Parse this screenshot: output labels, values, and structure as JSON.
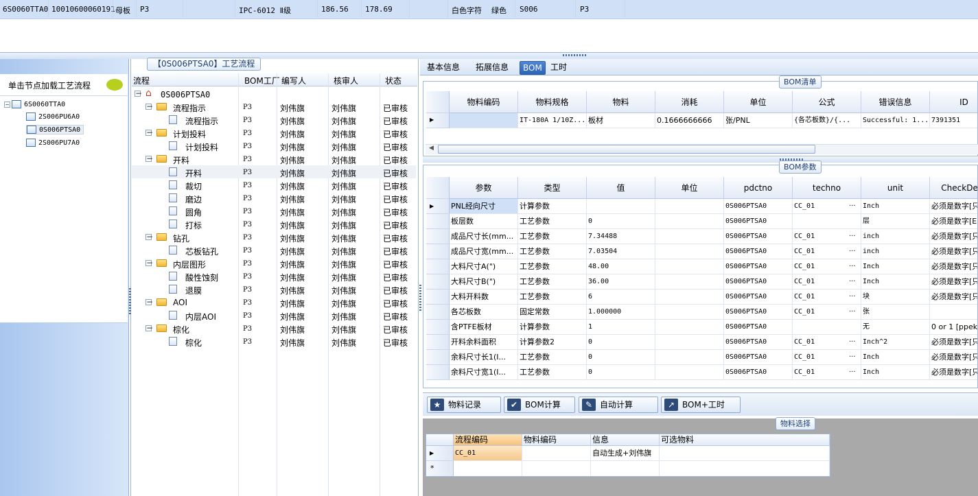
{
  "top_record": {
    "cells": [
      "6S0060TTA0",
      "10010600060191",
      "母板",
      "P3",
      "IPC-6012 Ⅱ级",
      "186.56",
      "178.69",
      "白色字符",
      "绿色",
      "S006",
      "P3"
    ]
  },
  "left_panel": {
    "hint": "单击节点加载工艺流程",
    "tree": [
      "6S0060TTA0",
      "2S006PU6A0",
      "0S006PTSA0",
      "2S006PU7A0"
    ]
  },
  "process_panel": {
    "title": "【0S006PTSA0】工艺流程",
    "columns": [
      "流程",
      "BOM工厂",
      "编写人",
      "核审人",
      "状态"
    ],
    "root": "0S006PTSA0",
    "rows": [
      {
        "name": "流程指示",
        "level": 1,
        "folder": true,
        "factory": "P3",
        "writer": "刘伟旗",
        "reviewer": "刘伟旗",
        "status": "已审核"
      },
      {
        "name": "流程指示",
        "level": 2,
        "folder": false,
        "factory": "P3",
        "writer": "刘伟旗",
        "reviewer": "刘伟旗",
        "status": "已审核"
      },
      {
        "name": "计划投料",
        "level": 1,
        "folder": true,
        "factory": "P3",
        "writer": "刘伟旗",
        "reviewer": "刘伟旗",
        "status": "已审核"
      },
      {
        "name": "计划投料",
        "level": 2,
        "folder": false,
        "factory": "P3",
        "writer": "刘伟旗",
        "reviewer": "刘伟旗",
        "status": "已审核"
      },
      {
        "name": "开料",
        "level": 1,
        "folder": true,
        "factory": "P3",
        "writer": "刘伟旗",
        "reviewer": "刘伟旗",
        "status": "已审核"
      },
      {
        "name": "开料",
        "level": 2,
        "folder": false,
        "factory": "P3",
        "writer": "刘伟旗",
        "reviewer": "刘伟旗",
        "status": "已审核"
      },
      {
        "name": "裁切",
        "level": 2,
        "folder": false,
        "factory": "P3",
        "writer": "刘伟旗",
        "reviewer": "刘伟旗",
        "status": "已审核"
      },
      {
        "name": "磨边",
        "level": 2,
        "folder": false,
        "factory": "P3",
        "writer": "刘伟旗",
        "reviewer": "刘伟旗",
        "status": "已审核"
      },
      {
        "name": "圆角",
        "level": 2,
        "folder": false,
        "factory": "P3",
        "writer": "刘伟旗",
        "reviewer": "刘伟旗",
        "status": "已审核"
      },
      {
        "name": "打标",
        "level": 2,
        "folder": false,
        "factory": "P3",
        "writer": "刘伟旗",
        "reviewer": "刘伟旗",
        "status": "已审核"
      },
      {
        "name": "钻孔",
        "level": 1,
        "folder": true,
        "factory": "P3",
        "writer": "刘伟旗",
        "reviewer": "刘伟旗",
        "status": "已审核"
      },
      {
        "name": "芯板钻孔",
        "level": 2,
        "folder": false,
        "factory": "P3",
        "writer": "刘伟旗",
        "reviewer": "刘伟旗",
        "status": "已审核"
      },
      {
        "name": "内层图形",
        "level": 1,
        "folder": true,
        "factory": "P3",
        "writer": "刘伟旗",
        "reviewer": "刘伟旗",
        "status": "已审核"
      },
      {
        "name": "酸性蚀刻",
        "level": 2,
        "folder": false,
        "factory": "P3",
        "writer": "刘伟旗",
        "reviewer": "刘伟旗",
        "status": "已审核"
      },
      {
        "name": "退膜",
        "level": 2,
        "folder": false,
        "factory": "P3",
        "writer": "刘伟旗",
        "reviewer": "刘伟旗",
        "status": "已审核"
      },
      {
        "name": "AOI",
        "level": 1,
        "folder": true,
        "factory": "P3",
        "writer": "刘伟旗",
        "reviewer": "刘伟旗",
        "status": "已审核"
      },
      {
        "name": "内层AOI",
        "level": 2,
        "folder": false,
        "factory": "P3",
        "writer": "刘伟旗",
        "reviewer": "刘伟旗",
        "status": "已审核"
      },
      {
        "name": "棕化",
        "level": 1,
        "folder": true,
        "factory": "P3",
        "writer": "刘伟旗",
        "reviewer": "刘伟旗",
        "status": "已审核"
      },
      {
        "name": "棕化",
        "level": 2,
        "folder": false,
        "factory": "P3",
        "writer": "刘伟旗",
        "reviewer": "刘伟旗",
        "status": "已审核"
      }
    ]
  },
  "tabs": [
    "基本信息",
    "拓展信息",
    "BOM",
    "工时"
  ],
  "active_tab": "BOM",
  "bom_list": {
    "title": "BOM清单",
    "columns": [
      "物料编码",
      "物料规格",
      "物料",
      "消耗",
      "单位",
      "公式",
      "错误信息",
      "ID"
    ],
    "rows": [
      [
        "",
        "IT-180A 1/10Z...",
        "板材",
        "0.1666666666",
        "张/PNL",
        "{各芯板数}/{...",
        "Successful: 1...",
        "7391351"
      ]
    ]
  },
  "bom_params": {
    "title": "BOM参数",
    "columns": [
      "参数",
      "类型",
      "值",
      "单位",
      "pdctno",
      "techno",
      "unit",
      "CheckDesc"
    ],
    "rows": [
      [
        "PNL经向尺寸",
        "计算参数",
        "",
        "",
        "0S006PTSA0",
        "CC_01",
        "Inch",
        "必须是数字[只"
      ],
      [
        "板层数",
        "工艺参数",
        "0",
        "",
        "0S006PTSA0",
        "",
        "层",
        "必须是数字[E"
      ],
      [
        "成品尺寸长(mm...",
        "工艺参数",
        "7.34488",
        "",
        "0S006PTSA0",
        "CC_01",
        "inch",
        "必须是数字[只"
      ],
      [
        "成品尺寸宽(mm...",
        "工艺参数",
        "7.03504",
        "",
        "0S006PTSA0",
        "CC_01",
        "inch",
        "必须是数字[只"
      ],
      [
        "大料尺寸A(\")",
        "工艺参数",
        "48.00",
        "",
        "0S006PTSA0",
        "CC_01",
        "Inch",
        "必须是数字[只"
      ],
      [
        "大料尺寸B(\")",
        "工艺参数",
        "36.00",
        "",
        "0S006PTSA0",
        "CC_01",
        "Inch",
        "必须是数字[只"
      ],
      [
        "大料开料数",
        "工艺参数",
        "6",
        "",
        "0S006PTSA0",
        "CC_01",
        "块",
        "必须是数字[只"
      ],
      [
        "各芯板数",
        "固定常数",
        "1.000000",
        "",
        "0S006PTSA0",
        "CC_01",
        "张",
        ""
      ],
      [
        "含PTFE板材",
        "计算参数",
        "1",
        "",
        "0S006PTSA0",
        "",
        "无",
        "0 or 1 [ppek"
      ],
      [
        "开料余料面积",
        "计算参数2",
        "0",
        "",
        "0S006PTSA0",
        "CC_01",
        "Inch^2",
        "必须是数字[只"
      ],
      [
        "余料尺寸长1(I...",
        "工艺参数",
        "0",
        "",
        "0S006PTSA0",
        "CC_01",
        "Inch",
        "必须是数字[只"
      ],
      [
        "余料尺寸宽1(I...",
        "工艺参数",
        "0",
        "",
        "0S006PTSA0",
        "CC_01",
        "Inch",
        "必须是数字[只"
      ]
    ]
  },
  "buttons": {
    "material_record": "物料记录",
    "bom_calc": "BOM计算",
    "auto_calc": "自动计算",
    "bom_hours": "BOM+工时"
  },
  "material_select": {
    "title": "物料选择",
    "columns": [
      "流程编码",
      "物料编码",
      "信息",
      "可选物料"
    ],
    "rows": [
      [
        "CC_01",
        "",
        "自动生成+刘伟旗",
        ""
      ]
    ],
    "new_row_marker": "*"
  },
  "colors": {
    "selected_row": "#cfe0f7",
    "active_tab": "#2d63b8",
    "highlight_cell": "#f6c88c"
  }
}
